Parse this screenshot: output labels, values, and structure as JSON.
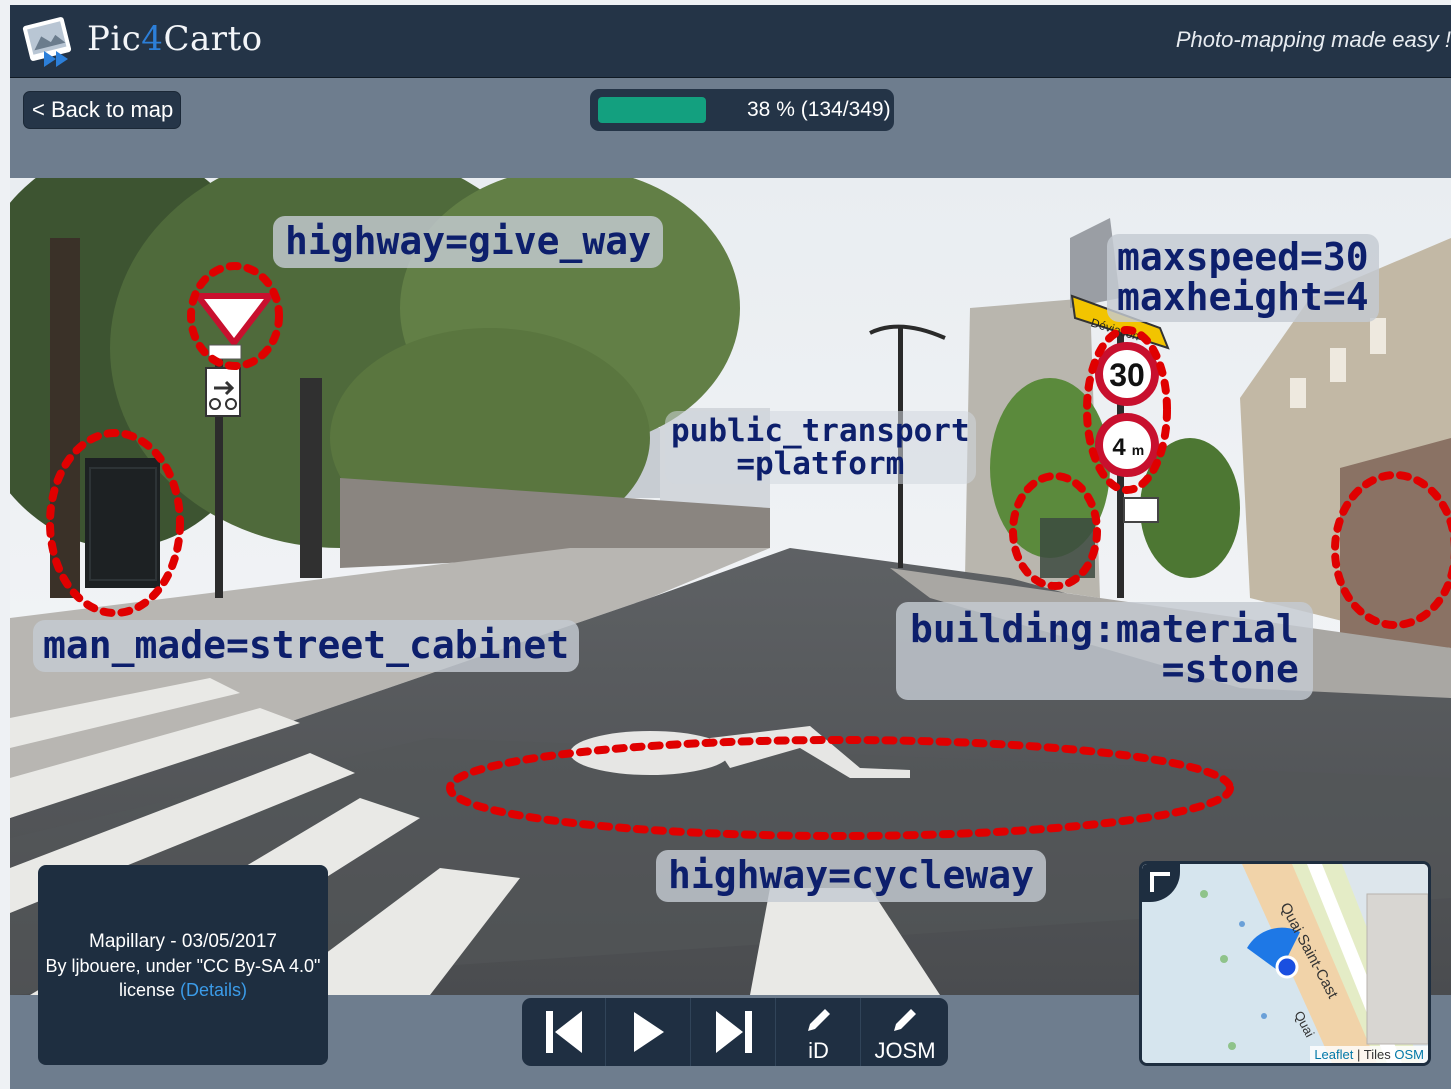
{
  "header": {
    "brand_prefix": "Pic",
    "brand_accent": "4",
    "brand_suffix": "Carto",
    "tagline": "Photo-mapping made easy !"
  },
  "toolbar": {
    "back_label": "< Back to map",
    "progress": {
      "fraction": 0.38,
      "text": "38 % (134/349)"
    }
  },
  "photo": {
    "tags": {
      "give_way": "highway=give_way",
      "maxspeed": "maxspeed=30\nmaxheight=4",
      "platform": "public_transport\n=platform",
      "cabinet": "man_made=street_cabinet",
      "material": "building:material\n=stone",
      "cycleway": "highway=cycleway"
    },
    "signs": {
      "speed": "30",
      "height": "4",
      "height_unit": "m",
      "detour": "Déviation"
    }
  },
  "attribution": {
    "source_line": "Mapillary - 03/05/2017",
    "author_line": "By ljbouere, under \"CC By-SA 4.0\"",
    "license_prefix": "license ",
    "details_label": "(Details)"
  },
  "controls": {
    "first_icon": "skip-back-icon",
    "play_icon": "play-icon",
    "last_icon": "skip-forward-icon",
    "id_label": "iD",
    "josm_label": "JOSM"
  },
  "minimap": {
    "street_label": "Quai Saint-Cast",
    "street_label_2": "Quai",
    "leaflet_label": "Leaflet",
    "separator": "|",
    "tiles_prefix": "Tiles",
    "osm_label": "OSM"
  },
  "colors": {
    "header_bg": "#243447",
    "accent_blue": "#2c7fd9",
    "progress_fill": "#13a07f",
    "tag_text": "#0d1f6c",
    "highlight_red": "#e00000"
  }
}
